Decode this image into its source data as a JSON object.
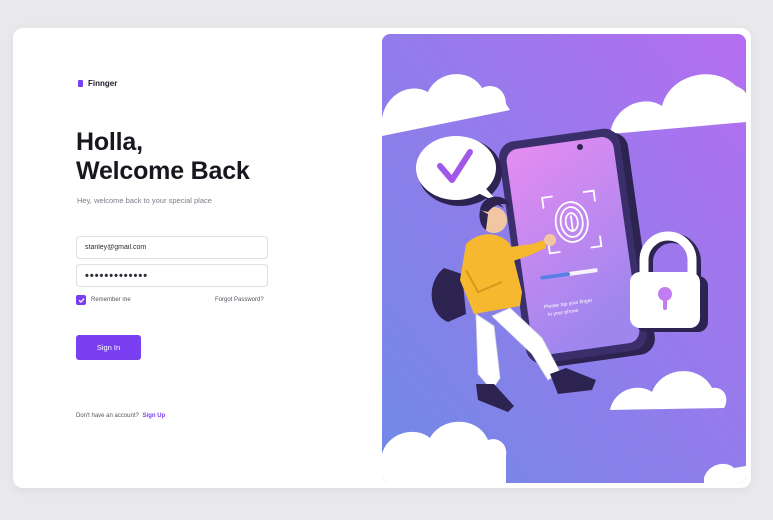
{
  "brand": {
    "name": "Finnger",
    "logo_icon": "phone-logo-icon"
  },
  "welcome": {
    "line1": "Holla,",
    "line2": "Welcome Back",
    "subtitle": "Hey, welcome back to your special place"
  },
  "form": {
    "email_value": "stanley@gmail.com",
    "password_value": "•••••••••••••",
    "remember_label": "Remember me",
    "remember_checked": true,
    "forgot_label": "Forgot Password?",
    "signin_label": "Sign In"
  },
  "footer": {
    "prompt": "Don't have an account?",
    "signup_label": "Sign Up"
  },
  "illustration": {
    "phone_text_line1": "Please tap your finger",
    "phone_text_line2": "to your phone",
    "icons": [
      "checkmark-bubble-icon",
      "fingerprint-icon",
      "padlock-icon",
      "cloud-icon"
    ]
  },
  "colors": {
    "accent": "#7b3ff2",
    "illustration_gradient_start": "#6f8ae6",
    "illustration_gradient_end": "#b56ef0",
    "jacket": "#f5b82e",
    "phone_frame": "#2c2350"
  }
}
